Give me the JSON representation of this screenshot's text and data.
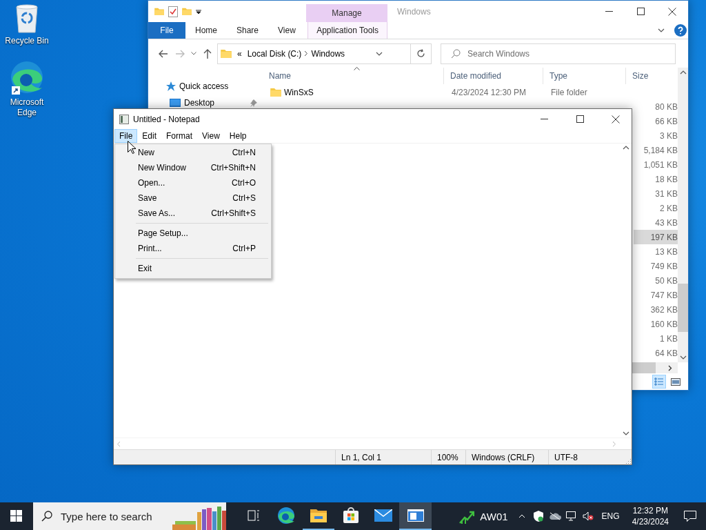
{
  "desktop": {
    "icons": [
      {
        "kind": "recycle-bin",
        "label": "Recycle Bin"
      },
      {
        "kind": "edge",
        "label": "Microsoft Edge"
      }
    ]
  },
  "explorer": {
    "title": "Windows",
    "context_tab": "Manage",
    "ribbon_tabs": [
      {
        "label": "File",
        "kind": "file"
      },
      {
        "label": "Home",
        "kind": "plain"
      },
      {
        "label": "Share",
        "kind": "plain"
      },
      {
        "label": "View",
        "kind": "plain"
      },
      {
        "label": "Application Tools",
        "kind": "context"
      }
    ],
    "address": {
      "overflow": "«",
      "segments": [
        "Local Disk (C:)",
        "Windows"
      ]
    },
    "search": {
      "placeholder": "Search Windows"
    },
    "navigation": [
      {
        "label": "Quick access",
        "kind": "star",
        "pinned": false
      },
      {
        "label": "Desktop",
        "kind": "desktop",
        "pinned": true
      }
    ],
    "columns": [
      "Name",
      "Date modified",
      "Type",
      "Size"
    ],
    "rows": [
      {
        "kind": "folder",
        "name": "WinSxS",
        "date": "4/23/2024 12:30 PM",
        "type": "File folder",
        "selected": false
      },
      {
        "size": "80 KB",
        "selected": false
      },
      {
        "size": "66 KB",
        "selected": false
      },
      {
        "size": "3 KB",
        "selected": false
      },
      {
        "size": "5,184 KB",
        "selected": false
      },
      {
        "size": "1,051 KB",
        "selected": false
      },
      {
        "size": "18 KB",
        "selected": false
      },
      {
        "size": "31 KB",
        "selected": false
      },
      {
        "size": "2 KB",
        "selected": false
      },
      {
        "size": "43 KB",
        "selected": false
      },
      {
        "size": "197 KB",
        "selected": true
      },
      {
        "size": "13 KB",
        "selected": false
      },
      {
        "size": "749 KB",
        "selected": false
      },
      {
        "size": "50 KB",
        "selected": false
      },
      {
        "size": "747 KB",
        "selected": false
      },
      {
        "size": "362 KB",
        "selected": false
      },
      {
        "size": "160 KB",
        "selected": false
      },
      {
        "size": "1 KB",
        "selected": false
      },
      {
        "size": "64 KB",
        "selected": false
      }
    ]
  },
  "notepad": {
    "title": "Untitled - Notepad",
    "menu": [
      {
        "label": "File",
        "selected": true
      },
      {
        "label": "Edit",
        "selected": false
      },
      {
        "label": "Format",
        "selected": false
      },
      {
        "label": "View",
        "selected": false
      },
      {
        "label": "Help",
        "selected": false
      }
    ],
    "file_menu": [
      {
        "items": [
          {
            "label": "New",
            "shortcut": "Ctrl+N"
          },
          {
            "label": "New Window",
            "shortcut": "Ctrl+Shift+N"
          },
          {
            "label": "Open...",
            "shortcut": "Ctrl+O"
          },
          {
            "label": "Save",
            "shortcut": "Ctrl+S"
          },
          {
            "label": "Save As...",
            "shortcut": "Ctrl+Shift+S"
          }
        ]
      },
      {
        "items": [
          {
            "label": "Page Setup..."
          },
          {
            "label": "Print...",
            "shortcut": "Ctrl+P"
          }
        ]
      },
      {
        "items": [
          {
            "label": "Exit"
          }
        ]
      }
    ],
    "status": [
      "Ln 1, Col 1",
      "100%",
      "Windows (CRLF)",
      "UTF-8"
    ]
  },
  "taskbar": {
    "search_placeholder": "Type here to search",
    "apps": [
      {
        "kind": "task-view",
        "running": false,
        "selected": false
      },
      {
        "kind": "edge",
        "running": false,
        "selected": false
      },
      {
        "kind": "file-explorer",
        "running": true,
        "selected": false
      },
      {
        "kind": "store",
        "running": false,
        "selected": false
      },
      {
        "kind": "mail",
        "running": false,
        "selected": false
      },
      {
        "kind": "notepad",
        "running": true,
        "selected": true
      }
    ],
    "widget": {
      "label": "AW01"
    },
    "language": "ENG",
    "time": "12:32 PM",
    "date": "4/23/2024"
  }
}
